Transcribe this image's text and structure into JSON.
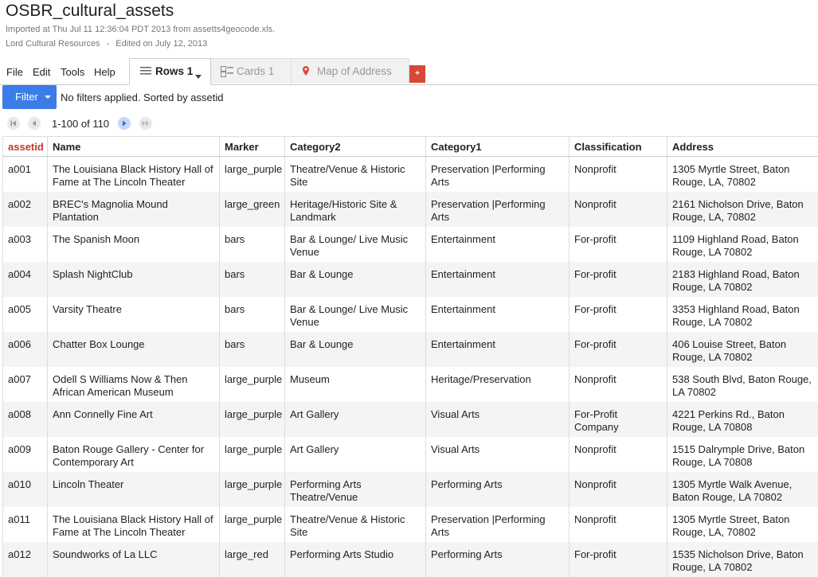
{
  "header": {
    "title": "OSBR_cultural_assets",
    "import_info": "Imported at Thu Jul 11 12:36:04 PDT 2013 from assetts4geocode.xls.",
    "owner": "Lord Cultural Resources",
    "separator": "-",
    "edited": "Edited on July 12, 2013"
  },
  "menu": {
    "file": "File",
    "edit": "Edit",
    "tools": "Tools",
    "help": "Help"
  },
  "tabs": {
    "rows": "Rows 1",
    "cards": "Cards 1",
    "map": "Map of Address",
    "add": "+"
  },
  "filter": {
    "button": "Filter",
    "status": "No filters applied. Sorted by assetid"
  },
  "pager": {
    "range": "1-100 of 110"
  },
  "colors": {
    "accent": "#3b7ce6",
    "sort_header": "#c0392b",
    "add_tab": "#d64937",
    "map_pin": "#d64937"
  },
  "table": {
    "columns": [
      "assetid",
      "Name",
      "Marker",
      "Category2",
      "Category1",
      "Classification",
      "Address"
    ],
    "rows": [
      [
        "a001",
        "The Louisiana Black History Hall of Fame at The Lincoln Theater",
        "large_purple",
        "Theatre/Venue & Historic Site",
        "Preservation |Performing Arts",
        "Nonprofit",
        "1305 Myrtle Street, Baton Rouge, LA, 70802"
      ],
      [
        "a002",
        "BREC's Magnolia Mound Plantation",
        "large_green",
        "Heritage/Historic Site & Landmark",
        "Preservation |Performing Arts",
        "Nonprofit",
        "2161 Nicholson Drive, Baton Rouge, LA, 70802"
      ],
      [
        "a003",
        "The Spanish Moon",
        "bars",
        "Bar & Lounge/ Live Music Venue",
        "Entertainment",
        "For-profit",
        "1109 Highland Road, Baton Rouge, LA 70802"
      ],
      [
        "a004",
        "Splash NightClub",
        "bars",
        "Bar & Lounge",
        "Entertainment",
        "For-profit",
        "2183 Highland Road, Baton Rouge, LA 70802"
      ],
      [
        "a005",
        "Varsity Theatre",
        "bars",
        "Bar & Lounge/ Live Music Venue",
        "Entertainment",
        "For-profit",
        "3353 Highland Road, Baton Rouge, LA 70802"
      ],
      [
        "a006",
        "Chatter Box Lounge",
        "bars",
        "Bar & Lounge",
        "Entertainment",
        "For-profit",
        "406 Louise Street, Baton Rouge, LA 70802"
      ],
      [
        "a007",
        "Odell S Williams Now & Then African American Museum",
        "large_purple",
        "Museum",
        "Heritage/Preservation",
        "Nonprofit",
        "538 South Blvd, Baton Rouge, LA 70802"
      ],
      [
        "a008",
        "Ann Connelly Fine Art",
        "large_purple",
        "Art Gallery",
        "Visual Arts",
        "For-Profit Company",
        "4221 Perkins Rd., Baton Rouge, LA 70808"
      ],
      [
        "a009",
        "Baton Rouge Gallery - Center for Contemporary Art",
        "large_purple",
        "Art Gallery",
        "Visual Arts",
        "Nonprofit",
        "1515 Dalrymple Drive, Baton Rouge, LA 70808"
      ],
      [
        "a010",
        "Lincoln Theater",
        "large_purple",
        "Performing Arts Theatre/Venue",
        "Performing Arts",
        "Nonprofit",
        "1305 Myrtle Walk Avenue, Baton Rouge, LA 70802"
      ],
      [
        "a011",
        "The Louisiana Black History Hall of Fame at The Lincoln Theater",
        "large_purple",
        "Theatre/Venue & Historic Site",
        "Preservation |Performing Arts",
        "Nonprofit",
        "1305 Myrtle Street, Baton Rouge, LA, 70802"
      ],
      [
        "a012",
        "Soundworks of La LLC",
        "large_red",
        "Performing Arts Studio",
        "Performing Arts",
        "For-profit",
        "1535 Nicholson Drive, Baton Rouge, LA 70802"
      ]
    ]
  }
}
